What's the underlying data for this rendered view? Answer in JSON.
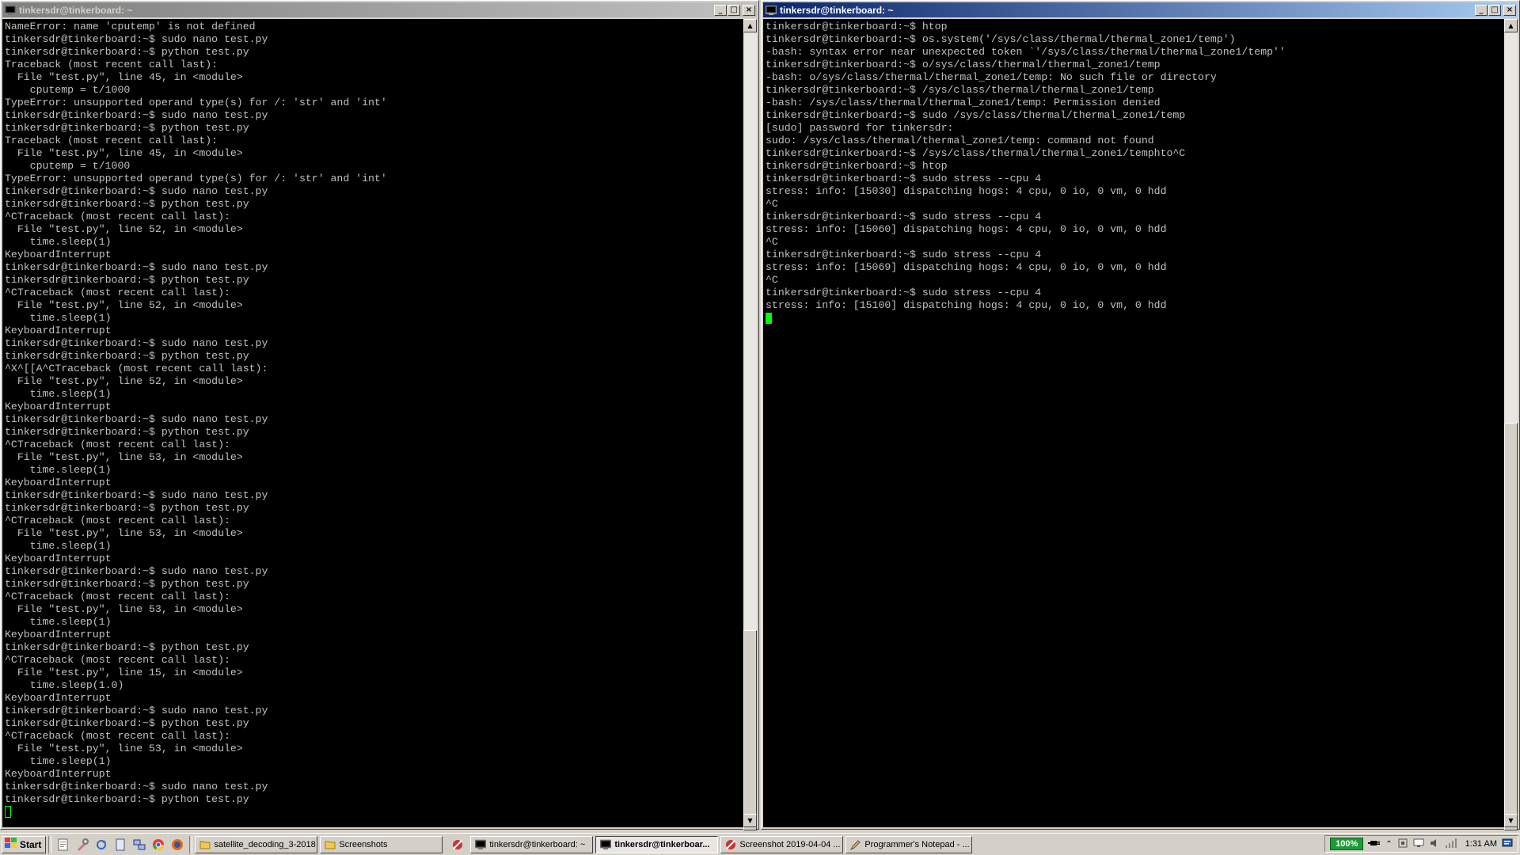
{
  "windows": {
    "left": {
      "title": "tinkersdr@tinkerboard: ~",
      "lines": [
        "NameError: name 'cputemp' is not defined",
        "tinkersdr@tinkerboard:~$ sudo nano test.py",
        "tinkersdr@tinkerboard:~$ python test.py",
        "Traceback (most recent call last):",
        "  File \"test.py\", line 45, in <module>",
        "    cputemp = t/1000",
        "TypeError: unsupported operand type(s) for /: 'str' and 'int'",
        "tinkersdr@tinkerboard:~$ sudo nano test.py",
        "tinkersdr@tinkerboard:~$ python test.py",
        "Traceback (most recent call last):",
        "  File \"test.py\", line 45, in <module>",
        "    cputemp = t/1000",
        "TypeError: unsupported operand type(s) for /: 'str' and 'int'",
        "tinkersdr@tinkerboard:~$ sudo nano test.py",
        "tinkersdr@tinkerboard:~$ python test.py",
        "^CTraceback (most recent call last):",
        "  File \"test.py\", line 52, in <module>",
        "    time.sleep(1)",
        "KeyboardInterrupt",
        "tinkersdr@tinkerboard:~$ sudo nano test.py",
        "tinkersdr@tinkerboard:~$ python test.py",
        "^CTraceback (most recent call last):",
        "  File \"test.py\", line 52, in <module>",
        "    time.sleep(1)",
        "KeyboardInterrupt",
        "tinkersdr@tinkerboard:~$ sudo nano test.py",
        "tinkersdr@tinkerboard:~$ python test.py",
        "^X^[[A^CTraceback (most recent call last):",
        "  File \"test.py\", line 52, in <module>",
        "    time.sleep(1)",
        "KeyboardInterrupt",
        "tinkersdr@tinkerboard:~$ sudo nano test.py",
        "tinkersdr@tinkerboard:~$ python test.py",
        "^CTraceback (most recent call last):",
        "  File \"test.py\", line 53, in <module>",
        "    time.sleep(1)",
        "KeyboardInterrupt",
        "tinkersdr@tinkerboard:~$ sudo nano test.py",
        "tinkersdr@tinkerboard:~$ python test.py",
        "^CTraceback (most recent call last):",
        "  File \"test.py\", line 53, in <module>",
        "    time.sleep(1)",
        "KeyboardInterrupt",
        "tinkersdr@tinkerboard:~$ sudo nano test.py",
        "tinkersdr@tinkerboard:~$ python test.py",
        "^CTraceback (most recent call last):",
        "  File \"test.py\", line 53, in <module>",
        "    time.sleep(1)",
        "KeyboardInterrupt",
        "tinkersdr@tinkerboard:~$ python test.py",
        "^CTraceback (most recent call last):",
        "  File \"test.py\", line 15, in <module>",
        "    time.sleep(1.0)",
        "KeyboardInterrupt",
        "tinkersdr@tinkerboard:~$ sudo nano test.py",
        "tinkersdr@tinkerboard:~$ python test.py",
        "^CTraceback (most recent call last):",
        "  File \"test.py\", line 53, in <module>",
        "    time.sleep(1)",
        "KeyboardInterrupt",
        "tinkersdr@tinkerboard:~$ sudo nano test.py",
        "tinkersdr@tinkerboard:~$ python test.py"
      ]
    },
    "right": {
      "title": "tinkersdr@tinkerboard: ~",
      "lines": [
        "tinkersdr@tinkerboard:~$ htop",
        "tinkersdr@tinkerboard:~$ os.system('/sys/class/thermal/thermal_zone1/temp')",
        "-bash: syntax error near unexpected token `'/sys/class/thermal/thermal_zone1/temp''",
        "tinkersdr@tinkerboard:~$ o/sys/class/thermal/thermal_zone1/temp",
        "-bash: o/sys/class/thermal/thermal_zone1/temp: No such file or directory",
        "tinkersdr@tinkerboard:~$ /sys/class/thermal/thermal_zone1/temp",
        "-bash: /sys/class/thermal/thermal_zone1/temp: Permission denied",
        "tinkersdr@tinkerboard:~$ sudo /sys/class/thermal/thermal_zone1/temp",
        "[sudo] password for tinkersdr:",
        "sudo: /sys/class/thermal/thermal_zone1/temp: command not found",
        "tinkersdr@tinkerboard:~$ /sys/class/thermal/thermal_zone1/temphto^C",
        "tinkersdr@tinkerboard:~$ htop",
        "tinkersdr@tinkerboard:~$ sudo stress --cpu 4",
        "stress: info: [15030] dispatching hogs: 4 cpu, 0 io, 0 vm, 0 hdd",
        "^C",
        "tinkersdr@tinkerboard:~$ sudo stress --cpu 4",
        "stress: info: [15060] dispatching hogs: 4 cpu, 0 io, 0 vm, 0 hdd",
        "^C",
        "tinkersdr@tinkerboard:~$ sudo stress --cpu 4",
        "stress: info: [15069] dispatching hogs: 4 cpu, 0 io, 0 vm, 0 hdd",
        "^C",
        "tinkersdr@tinkerboard:~$ sudo stress --cpu 4",
        "stress: info: [15100] dispatching hogs: 4 cpu, 0 io, 0 vm, 0 hdd"
      ]
    }
  },
  "window_buttons": {
    "minimize": "_",
    "maximize": "□",
    "close": "×"
  },
  "taskbar": {
    "start_label": "Start",
    "quick_launch": [
      "notepad-icon",
      "tools-icon",
      "refresh-icon",
      "document-icon",
      "network-icon",
      "chrome-icon",
      "firefox-icon"
    ],
    "tasks": [
      {
        "label": "satellite_decoding_3-2018",
        "icon": "folder-icon",
        "pressed": false
      },
      {
        "label": "Screenshots",
        "icon": "folder-icon",
        "pressed": false
      },
      {
        "label": "tinkersdr@tinkerboard: ~",
        "icon": "terminal-icon",
        "pressed": false
      },
      {
        "label": "tinkersdr@tinkerboar...",
        "icon": "terminal-icon",
        "pressed": true
      },
      {
        "label": "Screenshot 2019-04-04 ...",
        "icon": "paint-icon",
        "pressed": false
      },
      {
        "label": "Programmer's Notepad - ...",
        "icon": "pencil-icon",
        "pressed": false
      }
    ],
    "battery": "100%",
    "clock": "1:31 AM"
  },
  "colors": {
    "terminal_bg": "#000000",
    "terminal_fg": "#c0c0c0",
    "cursor": "#00ff00",
    "active_title": "#0a246a",
    "battery": "#1f9a3a"
  }
}
